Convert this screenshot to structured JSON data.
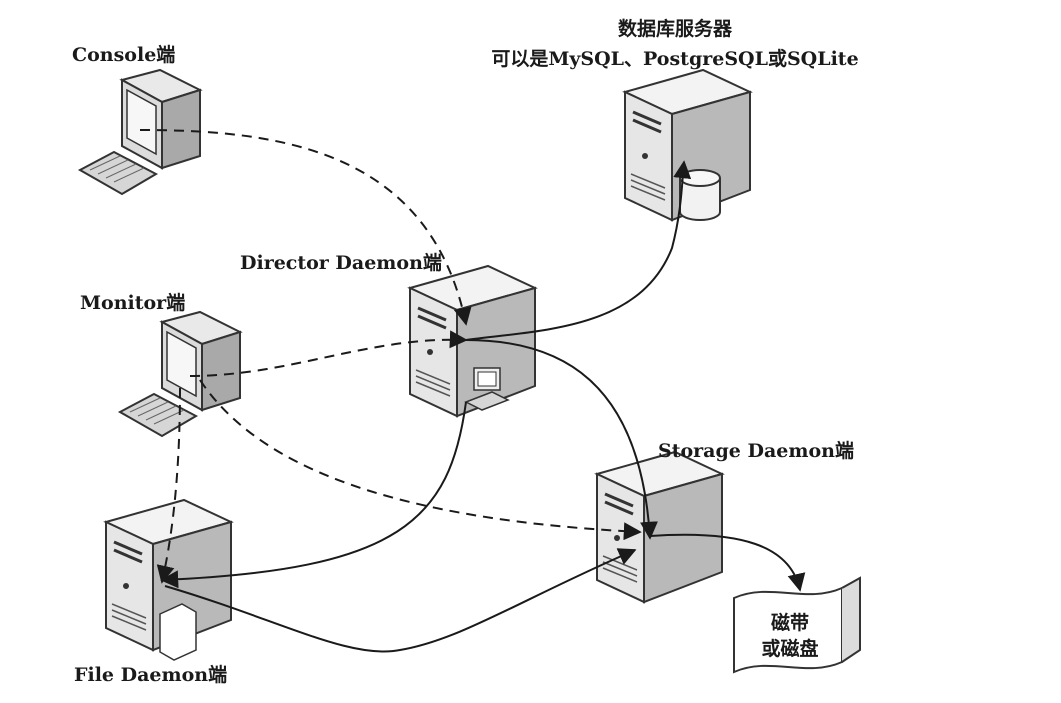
{
  "labels": {
    "console": "Console端",
    "db_title": "数据库服务器",
    "db_subtitle": "可以是MySQL、PostgreSQL或SQLite",
    "director": "Director Daemon端",
    "monitor": "Monitor端",
    "storage": "Storage Daemon端",
    "file": "File Daemon端",
    "tape_line1": "磁带",
    "tape_line2": "或磁盘"
  },
  "colors": {
    "ink": "#1a1a1a",
    "server_front": "#e6e6e6",
    "server_side": "#b9b9b9",
    "server_top": "#f3f3f3",
    "screen": "#f7f7f7"
  }
}
